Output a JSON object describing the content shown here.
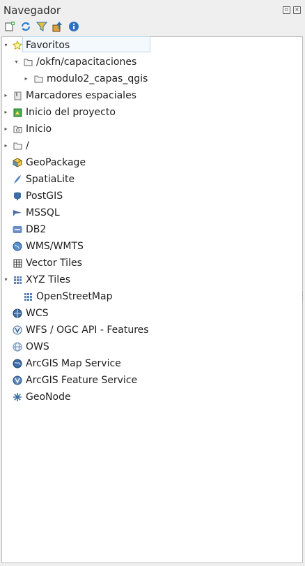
{
  "panel": {
    "title": "Navegador"
  },
  "title_buttons": [
    "float-icon",
    "close-icon"
  ],
  "toolbar": [
    {
      "name": "add-layer-button",
      "icon": "add-layer-icon"
    },
    {
      "name": "refresh-button",
      "icon": "refresh-icon"
    },
    {
      "name": "filter-button",
      "icon": "filter-icon"
    },
    {
      "name": "collapse-all-button",
      "icon": "collapse-icon"
    },
    {
      "name": "properties-button",
      "icon": "info-icon"
    }
  ],
  "tree": [
    {
      "label": "Favoritos",
      "icon": "star-icon",
      "expanded": true,
      "selected": true
    },
    {
      "label": "/okfn/capacitaciones",
      "icon": "folder-icon",
      "expanded": true
    },
    {
      "label": "modulo2_capas_qgis",
      "icon": "folder-icon",
      "expanded": false
    },
    {
      "label": "Marcadores espaciales",
      "icon": "bookmark-icon",
      "expanded": false
    },
    {
      "label": "Inicio del proyecto",
      "icon": "project-home-icon",
      "expanded": false
    },
    {
      "label": "Inicio",
      "icon": "home-icon",
      "expanded": false
    },
    {
      "label": "/",
      "icon": "folder-icon",
      "expanded": false
    },
    {
      "label": "GeoPackage",
      "icon": "geopackage-icon"
    },
    {
      "label": "SpatiaLite",
      "icon": "spatialite-icon"
    },
    {
      "label": "PostGIS",
      "icon": "postgis-icon"
    },
    {
      "label": "MSSQL",
      "icon": "mssql-icon"
    },
    {
      "label": "DB2",
      "icon": "db2-icon"
    },
    {
      "label": "WMS/WMTS",
      "icon": "wms-icon"
    },
    {
      "label": "Vector Tiles",
      "icon": "vector-tiles-icon"
    },
    {
      "label": "XYZ Tiles",
      "icon": "xyz-tiles-icon",
      "expanded": true
    },
    {
      "label": "OpenStreetMap",
      "icon": "xyz-tiles-icon"
    },
    {
      "label": "WCS",
      "icon": "wcs-icon"
    },
    {
      "label": "WFS / OGC API - Features",
      "icon": "wfs-icon"
    },
    {
      "label": "OWS",
      "icon": "ows-icon"
    },
    {
      "label": "ArcGIS Map Service",
      "icon": "arcgis-map-icon"
    },
    {
      "label": "ArcGIS Feature Service",
      "icon": "arcgis-feature-icon"
    },
    {
      "label": "GeoNode",
      "icon": "geonode-icon"
    }
  ]
}
